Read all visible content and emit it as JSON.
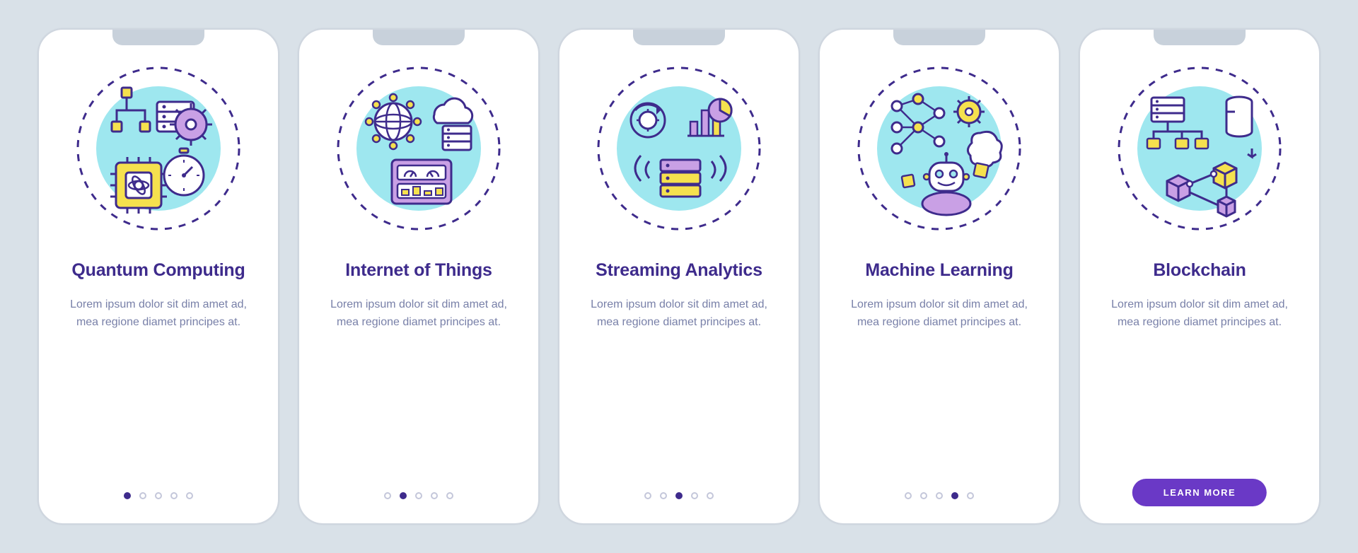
{
  "cards": [
    {
      "icon": "quantum-computing-icon",
      "title": "Quantum Computing",
      "desc": "Lorem ipsum dolor sit dim amet ad, mea regione diamet principes at.",
      "activeDot": 0,
      "cta": null
    },
    {
      "icon": "iot-icon",
      "title": "Internet of Things",
      "desc": "Lorem ipsum dolor sit dim amet ad, mea regione diamet principes at.",
      "activeDot": 1,
      "cta": null
    },
    {
      "icon": "streaming-analytics-icon",
      "title": "Streaming Analytics",
      "desc": "Lorem ipsum dolor sit dim amet ad, mea regione diamet principes at.",
      "activeDot": 2,
      "cta": null
    },
    {
      "icon": "machine-learning-icon",
      "title": "Machine Learning",
      "desc": "Lorem ipsum dolor sit dim amet ad, mea regione diamet principes at.",
      "activeDot": 3,
      "cta": null
    },
    {
      "icon": "blockchain-icon",
      "title": "Blockchain",
      "desc": "Lorem ipsum dolor sit dim amet ad, mea regione diamet principes at.",
      "activeDot": 4,
      "cta": "LEARN MORE"
    }
  ],
  "dotCount": 5,
  "palette": {
    "ink": "#3e2b8c",
    "cyan": "#9ee7ef",
    "purple": "#c9a0e5",
    "yellow": "#f5e14e",
    "btn": "#6a39c6"
  }
}
